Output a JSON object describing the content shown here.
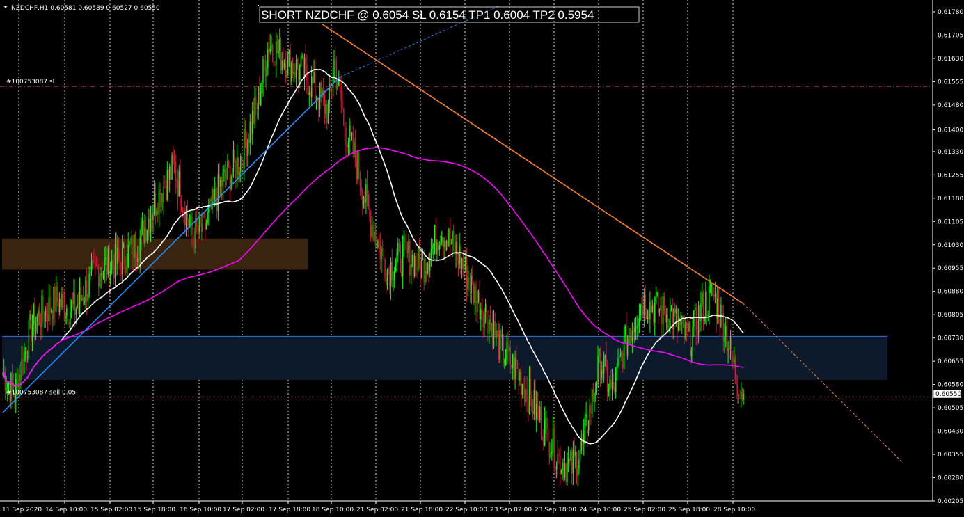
{
  "window": {
    "symbol_info": "NZDCHF,H1  0.60581 0.60589 0.60527 0.60550",
    "menu_icon": "triangle-down-icon"
  },
  "annotation": {
    "title": "SHORT NZDCHF @ 0.6054 SL 0.6154 TP1 0.6004 TP2 0.5954"
  },
  "levels": {
    "sl_label": "#100753087 sl",
    "sl_price": 0.6154,
    "entry_label": "#100753087 sell 0.05",
    "entry_price": 0.6054
  },
  "price_box": {
    "current_price_label": "0.60550",
    "current_price": 0.6055
  },
  "colors": {
    "background": "#000000",
    "bull": "#00ff00",
    "bear": "#dc143c",
    "ma_fast": "#ffffff",
    "ma_slow": "#ff00ff",
    "trendline_up": "#1e90ff",
    "trendline_down": "#ff7f27",
    "zone_upper": "#3a2410",
    "zone_lower": "#0d1a2c",
    "zone_lower_border": "#3a6fd8",
    "sl_line": "#c83c3c",
    "entry_line": "#5fbf5f",
    "grid": "#ffffff"
  },
  "chart_data": {
    "type": "candlestick",
    "symbol": "NZDCHF",
    "timeframe": "H1",
    "ylim": [
      0.602,
      0.618
    ],
    "y_ticks": [
      "0.61780",
      "0.61705",
      "0.61630",
      "0.61555",
      "0.61480",
      "0.61400",
      "0.61330",
      "0.61255",
      "0.61180",
      "0.61105",
      "0.61030",
      "0.60955",
      "0.60880",
      "0.60805",
      "0.60730",
      "0.60655",
      "0.60580",
      "0.60505",
      "0.60430",
      "0.60355",
      "0.60280",
      "0.60205"
    ],
    "x_ticks": [
      "11 Sep 2020",
      "14 Sep 10:00",
      "15 Sep 02:00",
      "15 Sep 18:00",
      "16 Sep 10:00",
      "17 Sep 02:00",
      "17 Sep 18:00",
      "18 Sep 10:00",
      "21 Sep 02:00",
      "21 Sep 18:00",
      "22 Sep 10:00",
      "23 Sep 02:00",
      "23 Sep 18:00",
      "24 Sep 10:00",
      "25 Sep 02:00",
      "25 Sep 18:00",
      "28 Sep 10:00"
    ],
    "close_anchors": [
      [
        0,
        0.6062
      ],
      [
        10,
        0.6055
      ],
      [
        25,
        0.6078
      ],
      [
        45,
        0.6085
      ],
      [
        60,
        0.6082
      ],
      [
        80,
        0.6095
      ],
      [
        100,
        0.6098
      ],
      [
        115,
        0.6104
      ],
      [
        130,
        0.6118
      ],
      [
        145,
        0.6128
      ],
      [
        160,
        0.6106
      ],
      [
        170,
        0.6108
      ],
      [
        185,
        0.6123
      ],
      [
        200,
        0.613
      ],
      [
        215,
        0.6148
      ],
      [
        225,
        0.6168
      ],
      [
        240,
        0.6162
      ],
      [
        255,
        0.6158
      ],
      [
        265,
        0.6152
      ],
      [
        275,
        0.6146
      ],
      [
        280,
        0.6162
      ],
      [
        290,
        0.614
      ],
      [
        300,
        0.6128
      ],
      [
        310,
        0.6112
      ],
      [
        325,
        0.6095
      ],
      [
        340,
        0.61
      ],
      [
        355,
        0.6096
      ],
      [
        370,
        0.6108
      ],
      [
        385,
        0.61
      ],
      [
        400,
        0.6086
      ],
      [
        410,
        0.608
      ],
      [
        420,
        0.607
      ],
      [
        435,
        0.6062
      ],
      [
        450,
        0.605
      ],
      [
        470,
        0.6034
      ],
      [
        480,
        0.6031
      ],
      [
        490,
        0.6038
      ],
      [
        505,
        0.6066
      ],
      [
        515,
        0.6055
      ],
      [
        525,
        0.607
      ],
      [
        540,
        0.6085
      ],
      [
        555,
        0.6082
      ],
      [
        565,
        0.608
      ],
      [
        580,
        0.6072
      ],
      [
        590,
        0.6082
      ],
      [
        600,
        0.6087
      ],
      [
        610,
        0.6077
      ],
      [
        620,
        0.606
      ],
      [
        626,
        0.6055
      ]
    ],
    "candle_count": 627,
    "moving_averages": [
      {
        "name": "",
        "period": 50,
        "color": "#ffffff"
      },
      {
        "name": "",
        "period": 200,
        "color": "#ff00ff"
      }
    ],
    "zones": [
      {
        "from_bar": 0,
        "to_bar": 270,
        "top": 0.6105,
        "bottom": 0.6095,
        "color": "#3a2410"
      },
      {
        "from_bar": 0,
        "to_bar": 740,
        "top": 0.60735,
        "bottom": 0.60595,
        "color": "#0d1a2c"
      }
    ],
    "trendlines": [
      {
        "from": [
          0,
          0.6049
        ],
        "to": [
          285,
          0.6157
        ],
        "extend_to": [
          420,
          0.618
        ],
        "color": "#1e90ff"
      },
      {
        "from": [
          270,
          0.6174
        ],
        "to": [
          626,
          0.6084
        ],
        "extend_to": [
          760,
          0.6033
        ],
        "color": "#ff7f27"
      }
    ],
    "grid": true
  }
}
